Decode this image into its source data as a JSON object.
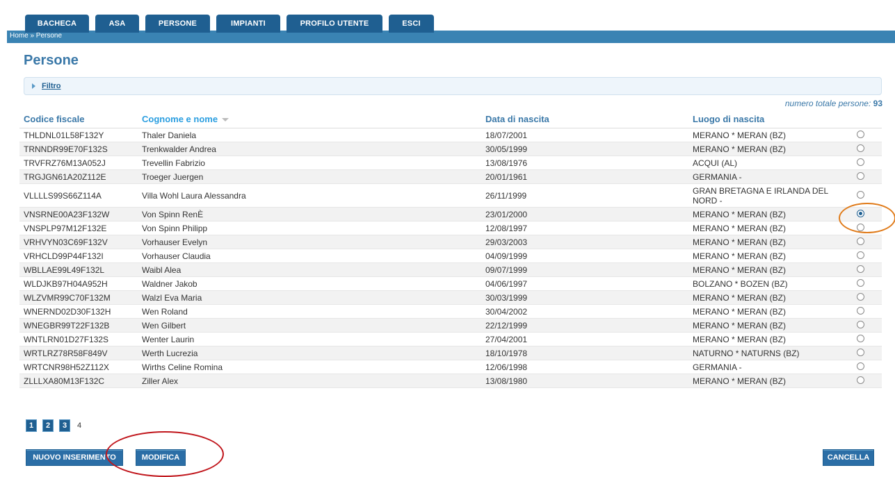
{
  "nav": {
    "tabs": [
      {
        "label": "BACHECA"
      },
      {
        "label": "ASA"
      },
      {
        "label": "PERSONE"
      },
      {
        "label": "IMPIANTI"
      },
      {
        "label": "PROFILO UTENTE"
      },
      {
        "label": "ESCI"
      }
    ],
    "breadcrumb": "Home » Persone"
  },
  "page": {
    "title": "Persone",
    "filter_label": "Filtro",
    "total_label": "numero totale persone:",
    "total_value": "93"
  },
  "table": {
    "columns": [
      "Codice fiscale",
      "Cognome e nome",
      "Data di nascita",
      "Luogo di nascita"
    ],
    "rows": [
      {
        "cf": "THLDNL01L58F132Y",
        "name": "Thaler Daniela",
        "dob": "18/07/2001",
        "place": "MERANO * MERAN (BZ)",
        "selected": false
      },
      {
        "cf": "TRNNDR99E70F132S",
        "name": "Trenkwalder Andrea",
        "dob": "30/05/1999",
        "place": "MERANO * MERAN (BZ)",
        "selected": false
      },
      {
        "cf": "TRVFRZ76M13A052J",
        "name": "Trevellin Fabrizio",
        "dob": "13/08/1976",
        "place": "ACQUI (AL)",
        "selected": false
      },
      {
        "cf": "TRGJGN61A20Z112E",
        "name": "Troeger Juergen",
        "dob": "20/01/1961",
        "place": "GERMANIA -",
        "selected": false
      },
      {
        "cf": "VLLLLS99S66Z114A",
        "name": "Villa Wohl Laura Alessandra",
        "dob": "26/11/1999",
        "place": "GRAN BRETAGNA E IRLANDA DEL NORD -",
        "selected": false
      },
      {
        "cf": "VNSRNE00A23F132W",
        "name": "Von Spinn RenÈ",
        "dob": "23/01/2000",
        "place": "MERANO * MERAN (BZ)",
        "selected": true
      },
      {
        "cf": "VNSPLP97M12F132E",
        "name": "Von Spinn Philipp",
        "dob": "12/08/1997",
        "place": "MERANO * MERAN (BZ)",
        "selected": false
      },
      {
        "cf": "VRHVYN03C69F132V",
        "name": "Vorhauser Evelyn",
        "dob": "29/03/2003",
        "place": "MERANO * MERAN (BZ)",
        "selected": false
      },
      {
        "cf": "VRHCLD99P44F132I",
        "name": "Vorhauser Claudia",
        "dob": "04/09/1999",
        "place": "MERANO * MERAN (BZ)",
        "selected": false
      },
      {
        "cf": "WBLLAE99L49F132L",
        "name": "Waibl Alea",
        "dob": "09/07/1999",
        "place": "MERANO * MERAN (BZ)",
        "selected": false
      },
      {
        "cf": "WLDJKB97H04A952H",
        "name": "Waldner Jakob",
        "dob": "04/06/1997",
        "place": "BOLZANO * BOZEN (BZ)",
        "selected": false
      },
      {
        "cf": "WLZVMR99C70F132M",
        "name": "Walzl Eva Maria",
        "dob": "30/03/1999",
        "place": "MERANO * MERAN (BZ)",
        "selected": false
      },
      {
        "cf": "WNERND02D30F132H",
        "name": "Wen Roland",
        "dob": "30/04/2002",
        "place": "MERANO * MERAN (BZ)",
        "selected": false
      },
      {
        "cf": "WNEGBR99T22F132B",
        "name": "Wen Gilbert",
        "dob": "22/12/1999",
        "place": "MERANO * MERAN (BZ)",
        "selected": false
      },
      {
        "cf": "WNTLRN01D27F132S",
        "name": "Wenter Laurin",
        "dob": "27/04/2001",
        "place": "MERANO * MERAN (BZ)",
        "selected": false
      },
      {
        "cf": "WRTLRZ78R58F849V",
        "name": "Werth Lucrezia",
        "dob": "18/10/1978",
        "place": "NATURNO * NATURNS (BZ)",
        "selected": false
      },
      {
        "cf": "WRTCNR98H52Z112X",
        "name": "Wirths Celine Romina",
        "dob": "12/06/1998",
        "place": "GERMANIA -",
        "selected": false
      },
      {
        "cf": "ZLLLXA80M13F132C",
        "name": "Ziller Alex",
        "dob": "13/08/1980",
        "place": "MERANO * MERAN (BZ)",
        "selected": false
      }
    ]
  },
  "pagination": {
    "pages": [
      "1",
      "2",
      "3"
    ],
    "current": "4"
  },
  "actions": {
    "new_label": "NUOVO INSERIMENTO",
    "edit_label": "MODIFICA",
    "delete_label": "CANCELLA"
  },
  "colors": {
    "accent": "#1f5f91",
    "navstrip": "#3a83b3",
    "annotation": "#e07b1a",
    "annotation_red": "#c0151b"
  }
}
